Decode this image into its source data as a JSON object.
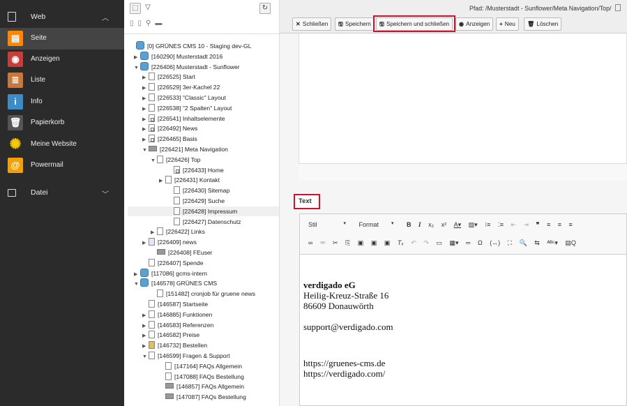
{
  "module_menu": {
    "group_web": {
      "label": "Web",
      "icon": "page-icon"
    },
    "items": [
      {
        "label": "Seite",
        "icon": "page-module-icon",
        "color": "#ff8700"
      },
      {
        "label": "Anzeigen",
        "icon": "eye-icon",
        "color": "#c83c3c"
      },
      {
        "label": "Liste",
        "icon": "list-icon",
        "color": "#c8783c"
      },
      {
        "label": "Info",
        "icon": "info-icon",
        "color": "#3c8cc8"
      },
      {
        "label": "Papierkorb",
        "icon": "trash-icon",
        "color": "#555555"
      },
      {
        "label": "Meine Website",
        "icon": "sunflower-icon",
        "color": "#f5c800"
      },
      {
        "label": "Powermail",
        "icon": "powermail-icon",
        "color": "#f5a000"
      }
    ],
    "group_datei": {
      "label": "Datei",
      "icon": "file-icon"
    }
  },
  "tree": {
    "rows": [
      {
        "text": "[0] GRÜNES CMS 10 - Staging dev-GL",
        "icon": "root"
      },
      {
        "text": "[160290] Musterstadt 2016",
        "icon": "root",
        "toggle": "▶"
      },
      {
        "text": "[226406] Musterstadt - Sunflower",
        "icon": "root",
        "toggle": "▼"
      },
      {
        "text": "[226525] Start",
        "icon": "page",
        "toggle": "▶"
      },
      {
        "text": "[226529] 3er-Kachel 22",
        "icon": "page",
        "toggle": "▶"
      },
      {
        "text": "[226533] \"Classic\" Layout",
        "icon": "page",
        "toggle": "▶"
      },
      {
        "text": "[226538] \"2 Spalten\" Layout",
        "icon": "page",
        "toggle": "▶"
      },
      {
        "text": "[226541] Inhaltselemente",
        "icon": "ent",
        "toggle": "▶"
      },
      {
        "text": "[226492] News",
        "icon": "ent",
        "toggle": "▶"
      },
      {
        "text": "[226465] Basis",
        "icon": "ent",
        "toggle": "▶"
      },
      {
        "text": "[226421] Meta Navigation",
        "icon": "fold",
        "toggle": "▼"
      },
      {
        "text": "[226426] Top",
        "icon": "page",
        "toggle": "▼"
      },
      {
        "text": "[226433] Home",
        "icon": "ent"
      },
      {
        "text": "[226431] Kontakt",
        "icon": "page",
        "toggle": "▶"
      },
      {
        "text": "[226430] Sitemap",
        "icon": "page"
      },
      {
        "text": "[226429] Suche",
        "icon": "page"
      },
      {
        "text": "[226428] Impressum",
        "icon": "page",
        "selected": true
      },
      {
        "text": "[226427] Datenschutz",
        "icon": "page"
      },
      {
        "text": "[226422] Links",
        "icon": "page",
        "toggle": "▶"
      },
      {
        "text": "[226409] news",
        "icon": "news",
        "toggle": "▶"
      },
      {
        "text": "[226408] FEuser",
        "icon": "fold"
      },
      {
        "text": "[226407] Spende",
        "icon": "page"
      },
      {
        "text": "[117086] gcms-intern",
        "icon": "root",
        "toggle": "▶"
      },
      {
        "text": "[146578] GRÜNES CMS",
        "icon": "root",
        "toggle": "▼"
      },
      {
        "text": "[151482] cronjob für gruene news",
        "icon": "page"
      },
      {
        "text": "[146587] Startseite",
        "icon": "page"
      },
      {
        "text": "[146885] Funktionen",
        "icon": "page",
        "toggle": "▶"
      },
      {
        "text": "[146583] Referenzen",
        "icon": "page",
        "toggle": "▶"
      },
      {
        "text": "[146582] Preise",
        "icon": "page",
        "toggle": "▶"
      },
      {
        "text": "[146732] Bestellen",
        "icon": "shop",
        "toggle": "▶"
      },
      {
        "text": "[146599] Fragen & Support",
        "icon": "page",
        "toggle": "▼"
      },
      {
        "text": "[147164] FAQs Allgemein",
        "icon": "page"
      },
      {
        "text": "[147088] FAQs Bestellung",
        "icon": "page"
      },
      {
        "text": "[146857] FAQs Allgemein",
        "icon": "fold"
      },
      {
        "text": "[147087] FAQs Bestellung",
        "icon": "fold"
      }
    ]
  },
  "docheader": {
    "path": "Pfad: /Musterstadt - Sunflower/Meta Navigation/Top/",
    "buttons": {
      "close": "Schließen",
      "save": "Speichern",
      "save_close": "Speichern und schließen",
      "view": "Anzeigen",
      "new": "Neu",
      "delete": "Löschen"
    }
  },
  "editor": {
    "field_label": "Text",
    "style_select": "Stil",
    "format_select": "Format",
    "body": {
      "company": "verdigado eG",
      "street": "Heilig-Kreuz-Straße 16",
      "city": "86609 Donauwörth",
      "email": "support@verdigado.com",
      "url1": "https://gruenes-cms.de",
      "url2": "https://verdigado.com/"
    }
  }
}
